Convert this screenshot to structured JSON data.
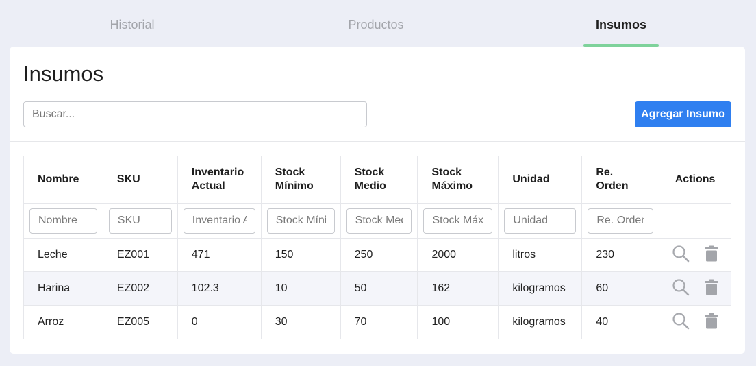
{
  "tabs": [
    {
      "label": "Historial"
    },
    {
      "label": "Productos"
    },
    {
      "label": "Insumos"
    }
  ],
  "page": {
    "title": "Insumos",
    "search_placeholder": "Buscar...",
    "add_button": "Agregar Insumo"
  },
  "table": {
    "headers": [
      "Nombre",
      "SKU",
      "Inventario Actual",
      "Stock Mínimo",
      "Stock Medio",
      "Stock Máximo",
      "Unidad",
      "Re. Orden",
      "Actions"
    ],
    "filters": [
      "Nombre",
      "SKU",
      "Inventario Actual",
      "Stock Mínimo",
      "Stock Medio",
      "Stock Máximo",
      "Unidad",
      "Re. Orden"
    ],
    "rows": [
      {
        "cells": [
          "Leche",
          "EZ001",
          "471",
          "150",
          "250",
          "2000",
          "litros",
          "230"
        ]
      },
      {
        "cells": [
          "Harina",
          "EZ002",
          "102.3",
          "10",
          "50",
          "162",
          "kilogramos",
          "60"
        ]
      },
      {
        "cells": [
          "Arroz",
          "EZ005",
          "0",
          "30",
          "70",
          "100",
          "kilogramos",
          "40"
        ]
      }
    ]
  },
  "icons": {
    "view": "search-icon",
    "delete": "trash-icon"
  },
  "colors": {
    "accent": "#2f7ff0",
    "active_tab_underline": "#7ed29b",
    "alt_row": "#f4f5fa"
  }
}
